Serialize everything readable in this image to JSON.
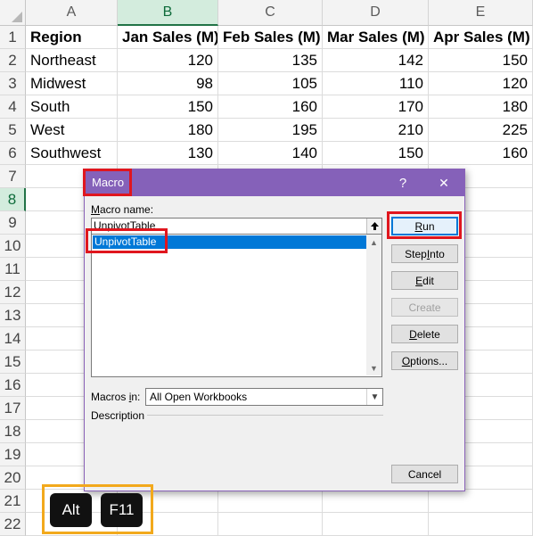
{
  "sheet": {
    "columns": [
      "A",
      "B",
      "C",
      "D",
      "E"
    ],
    "rows": [
      "1",
      "2",
      "3",
      "4",
      "5",
      "6",
      "7",
      "8",
      "9",
      "10",
      "11",
      "12",
      "13",
      "14",
      "15",
      "16",
      "17",
      "18",
      "19",
      "20",
      "21",
      "22"
    ],
    "headers": [
      "Region",
      "Jan Sales (M)",
      "Feb Sales (M)",
      "Mar Sales (M)",
      "Apr Sales (M)"
    ],
    "data": [
      [
        "Northeast",
        "120",
        "135",
        "142",
        "150"
      ],
      [
        "Midwest",
        "98",
        "105",
        "110",
        "120"
      ],
      [
        "South",
        "150",
        "160",
        "170",
        "180"
      ],
      [
        "West",
        "180",
        "195",
        "210",
        "225"
      ],
      [
        "Southwest",
        "130",
        "140",
        "150",
        "160"
      ]
    ]
  },
  "dialog": {
    "title": "Macro",
    "help": "?",
    "close": "✕",
    "macro_name_label": "Macro name:",
    "macro_name_value": "UnpivotTable",
    "macro_list": [
      "UnpivotTable"
    ],
    "buttons": {
      "run": "Run",
      "step_into": "Step Into",
      "edit": "Edit",
      "create": "Create",
      "delete": "Delete",
      "options": "Options...",
      "cancel": "Cancel"
    },
    "macros_in_label": "Macros in:",
    "macros_in_value": "All Open Workbooks",
    "description_label": "Description"
  },
  "shortcut": {
    "keys": [
      "Alt",
      "F11"
    ]
  },
  "colors": {
    "titlebar": "#8561b9",
    "selection": "#0078d7",
    "highlight_red": "#e0161e",
    "highlight_orange": "#f2a91c",
    "excel_green": "#217346"
  }
}
